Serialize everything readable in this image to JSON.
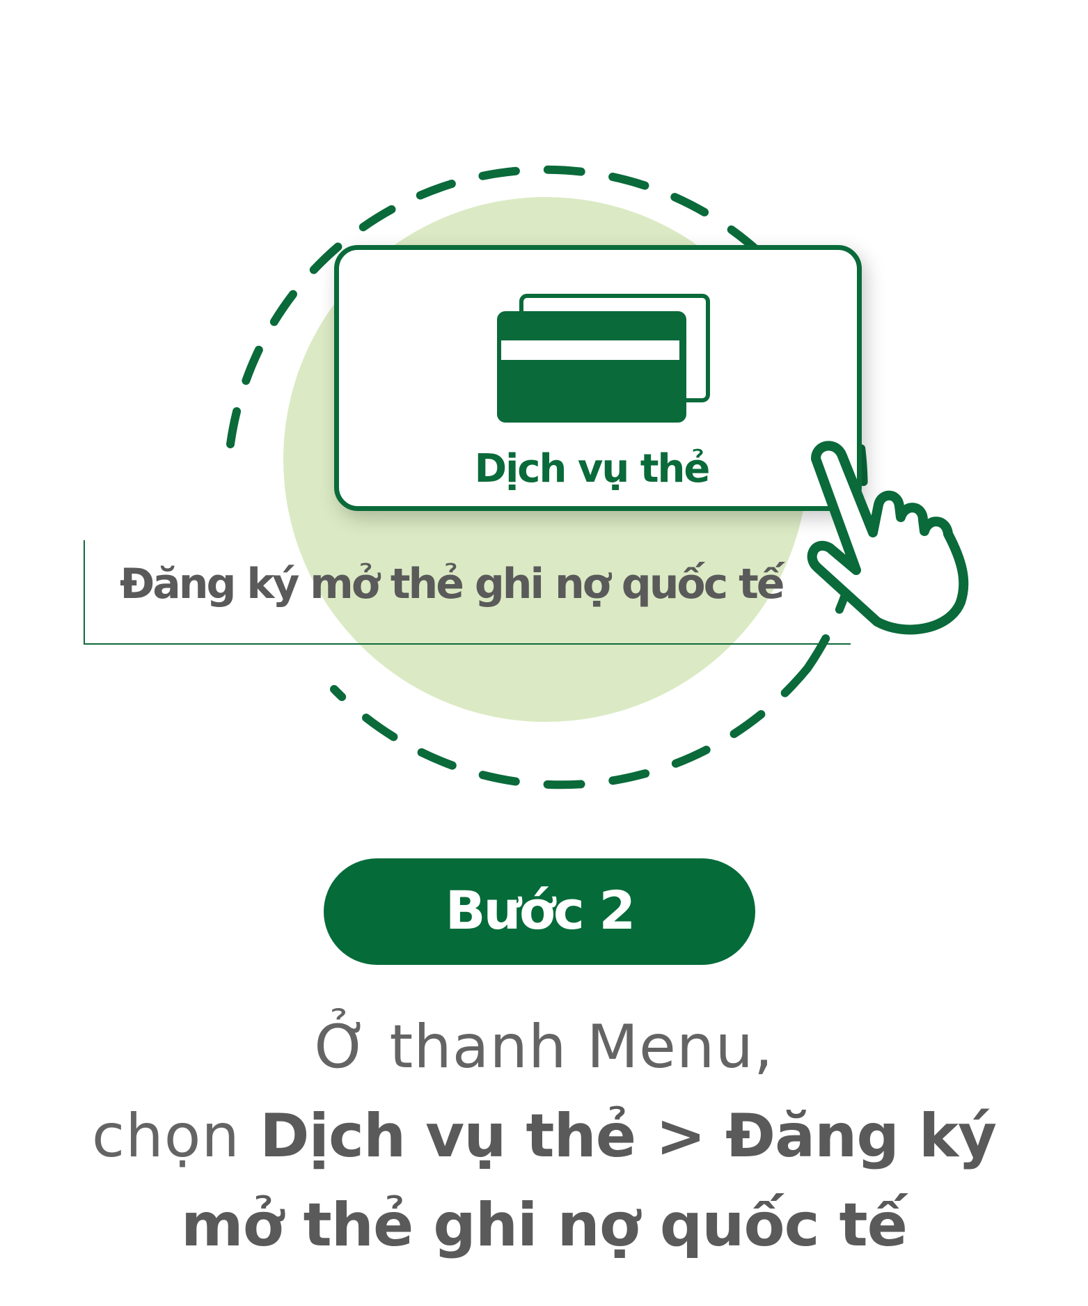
{
  "illustration": {
    "card_button_label": "Dịch vụ thẻ",
    "menu_item_label": "Đăng ký mở thẻ ghi nợ quốc tế",
    "card_icon": "credit-card-icon",
    "hand_icon": "pointing-hand-icon"
  },
  "step": {
    "label": "Bước 2"
  },
  "instruction": {
    "line1": "Ở thanh Menu,",
    "line2_prefix": "chọn ",
    "line2_bold": "Dịch vụ thẻ > Đăng ký",
    "line3_bold": "mở thẻ ghi nợ quốc tế"
  },
  "colors": {
    "brand_green": "#046b39",
    "light_green": "#dbeac4",
    "text_gray": "#646464",
    "white": "#ffffff"
  }
}
